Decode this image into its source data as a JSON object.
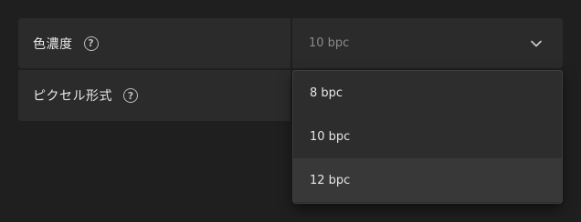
{
  "settings": {
    "color_depth": {
      "label": "色濃度",
      "help_glyph": "?",
      "value": "10 bpc"
    },
    "pixel_format": {
      "label": "ピクセル形式",
      "help_glyph": "?"
    }
  },
  "dropdown": {
    "options": [
      "8 bpc",
      "10 bpc",
      "12 bpc"
    ],
    "hovered_index": 2
  },
  "icons": {
    "help": "help-circle-icon",
    "chevron": "chevron-down-icon"
  },
  "colors": {
    "background": "#1f1f1f",
    "panel": "#2b2b2b",
    "dropdown": "#2d2d2d",
    "hover": "#383838"
  }
}
